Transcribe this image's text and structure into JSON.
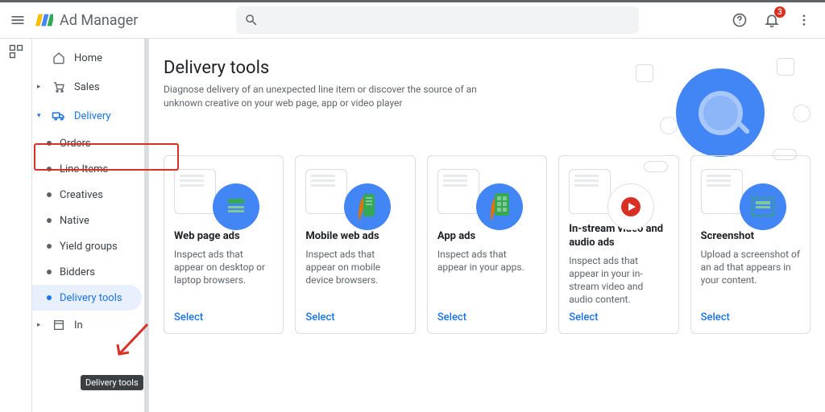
{
  "header": {
    "app_name": "Ad Manager",
    "notification_count": "3"
  },
  "sidebar": {
    "items": [
      {
        "label": "Home"
      },
      {
        "label": "Sales"
      },
      {
        "label": "Delivery"
      }
    ],
    "delivery_children": [
      {
        "label": "Orders"
      },
      {
        "label": "Line Items"
      },
      {
        "label": "Creatives"
      },
      {
        "label": "Native"
      },
      {
        "label": "Yield groups"
      },
      {
        "label": "Bidders"
      },
      {
        "label": "Delivery tools"
      }
    ],
    "last": "In",
    "tooltip": "Delivery tools"
  },
  "page": {
    "title": "Delivery tools",
    "desc": "Diagnose delivery of an unexpected line item or discover the source of an unknown creative on your web page, app or video player"
  },
  "cards": [
    {
      "title": "Web page ads",
      "desc": "Inspect ads that appear on desktop or laptop browsers.",
      "select": "Select"
    },
    {
      "title": "Mobile web ads",
      "desc": "Inspect ads that appear on mobile device browsers.",
      "select": "Select"
    },
    {
      "title": "App ads",
      "desc": "Inspect ads that appear in your apps.",
      "select": "Select"
    },
    {
      "title": "In-stream video and audio ads",
      "desc": "Inspect ads that appear in your in-stream video and audio content.",
      "select": "Select"
    },
    {
      "title": "Screenshot",
      "desc": "Upload a screenshot of an ad that appears in your content.",
      "select": "Select"
    }
  ]
}
